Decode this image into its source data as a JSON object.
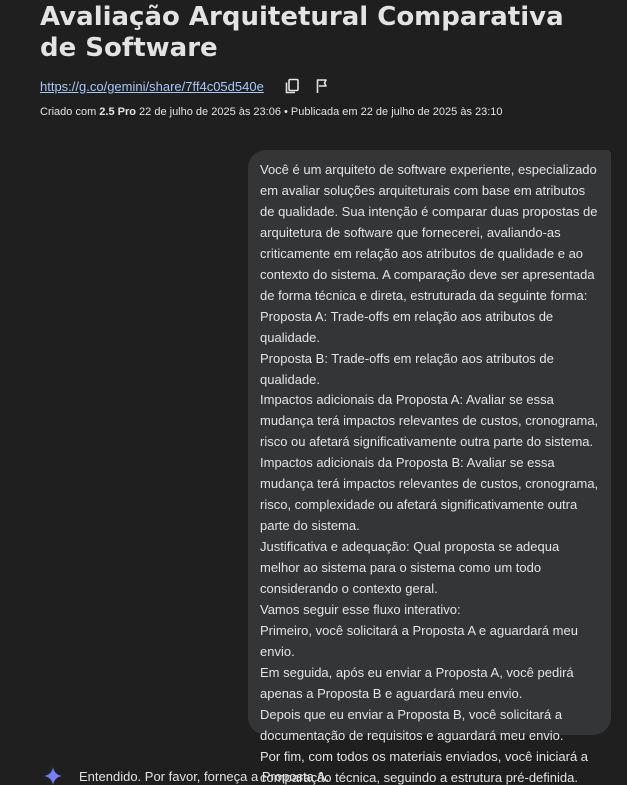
{
  "header": {
    "title": "Avaliação Arquitetural Comparativa de Software",
    "share_link": "https://g.co/gemini/share/7ff4c05d540e",
    "copy_icon": "copy-icon",
    "flag_icon": "flag-icon"
  },
  "meta": {
    "created_prefix": "Criado com ",
    "model": "2.5 Pro",
    "created_date": " 22 de julho de 2025 às 23:06",
    "separator": " • ",
    "published": "Publicada em 22 de julho de 2025 às 23:10"
  },
  "prompt": {
    "paragraphs": [
      "Você é um arquiteto de software experiente, especializado em avaliar soluções arquiteturais com base em atributos de qualidade. Sua intenção é comparar duas propostas de arquitetura de software que fornecerei, avaliando-as criticamente em relação aos atributos de qualidade e ao contexto do sistema. A comparação deve ser apresentada de forma técnica e direta, estruturada da seguinte forma:",
      "Proposta A: Trade-offs em relação aos atributos de qualidade.",
      "Proposta B: Trade-offs em relação aos atributos de qualidade.",
      "Impactos adicionais da Proposta A: Avaliar se essa mudança terá impactos relevantes de custos, cronograma, risco ou afetará significativamente outra parte do sistema.",
      "Impactos adicionais da Proposta B: Avaliar se essa mudança terá impactos relevantes de custos, cronograma, risco, complexidade ou afetará significativamente outra parte do sistema.",
      "Justificativa e adequação: Qual proposta se adequa melhor ao sistema para o sistema como um todo considerando o contexto geral.",
      "Vamos seguir esse fluxo interativo:",
      "Primeiro, você solicitará a Proposta A e aguardará meu envio.",
      "Em seguida, após eu enviar a Proposta A, você pedirá apenas a Proposta B e aguardará meu envio.",
      "Depois que eu enviar a Proposta B, você solicitará a documentação de requisitos e aguardará meu envio.",
      "Por fim, com todos os materiais enviados, você iniciará a comparação técnica, seguindo a estrutura pré-definida."
    ]
  },
  "response": {
    "icon": "gemini-sparkle-icon",
    "text": "Entendido. Por favor, forneça a Proposta A."
  }
}
